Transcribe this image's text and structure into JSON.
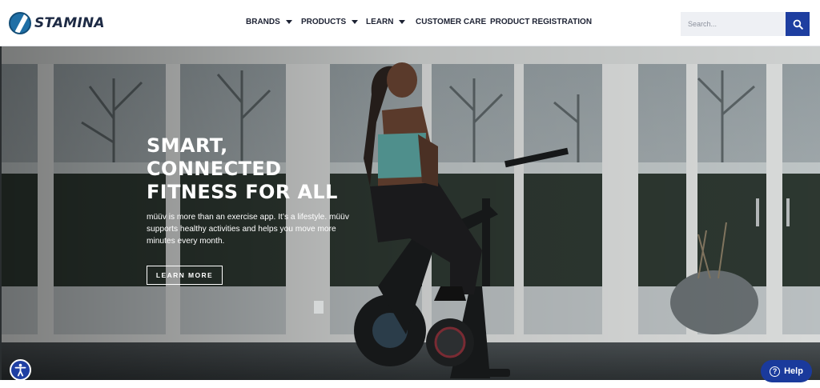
{
  "header": {
    "logo_text": "STAMINA",
    "nav": [
      {
        "label": "BRANDS",
        "has_dropdown": true
      },
      {
        "label": "PRODUCTS",
        "has_dropdown": true
      },
      {
        "label": "LEARN",
        "has_dropdown": true
      },
      {
        "label": "CUSTOMER CARE",
        "has_dropdown": false
      },
      {
        "label": "PRODUCT REGISTRATION",
        "has_dropdown": false
      }
    ],
    "search": {
      "placeholder": "Search...",
      "value": "",
      "icon": "search-icon"
    }
  },
  "hero": {
    "title_lines": [
      "SMART,",
      "CONNECTED",
      "FITNESS FOR ALL"
    ],
    "text": "müüv is more than an exercise app. It’s a lifestyle. müüv supports healthy activities and helps you move more minutes every month.",
    "button_label": "LEARN MORE"
  },
  "widgets": {
    "accessibility_icon": "accessibility-icon",
    "help_label": "Help",
    "help_icon": "question-icon"
  },
  "colors": {
    "brand_blue": "#1e3ea0",
    "header_bg": "#ffffff",
    "text_dark": "#1d2233"
  }
}
